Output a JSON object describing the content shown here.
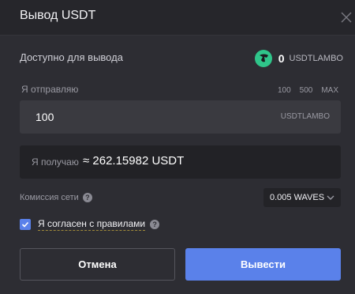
{
  "dialog": {
    "title": "Вывод USDT"
  },
  "available": {
    "label": "Доступно для вывода",
    "amount": "0",
    "ticker": "USDTLAMBO",
    "icon": "lambo-coin-icon"
  },
  "send": {
    "label": "Я отправляю",
    "quick_amounts": [
      "100",
      "500",
      "MAX"
    ],
    "value": "100",
    "ticker": "USDTLAMBO"
  },
  "receive": {
    "label": "Я получаю",
    "value": "≈ 262.15982 USDT"
  },
  "fee": {
    "label": "Комиссия сети",
    "selected": "0.005 WAVES"
  },
  "agreement": {
    "label": "Я согласен с правилами",
    "checked": true
  },
  "buttons": {
    "cancel": "Отмена",
    "submit": "Вывести"
  },
  "colors": {
    "background": "#2d2d33",
    "accent": "#5a81ea",
    "coin": "#2fc58a"
  }
}
